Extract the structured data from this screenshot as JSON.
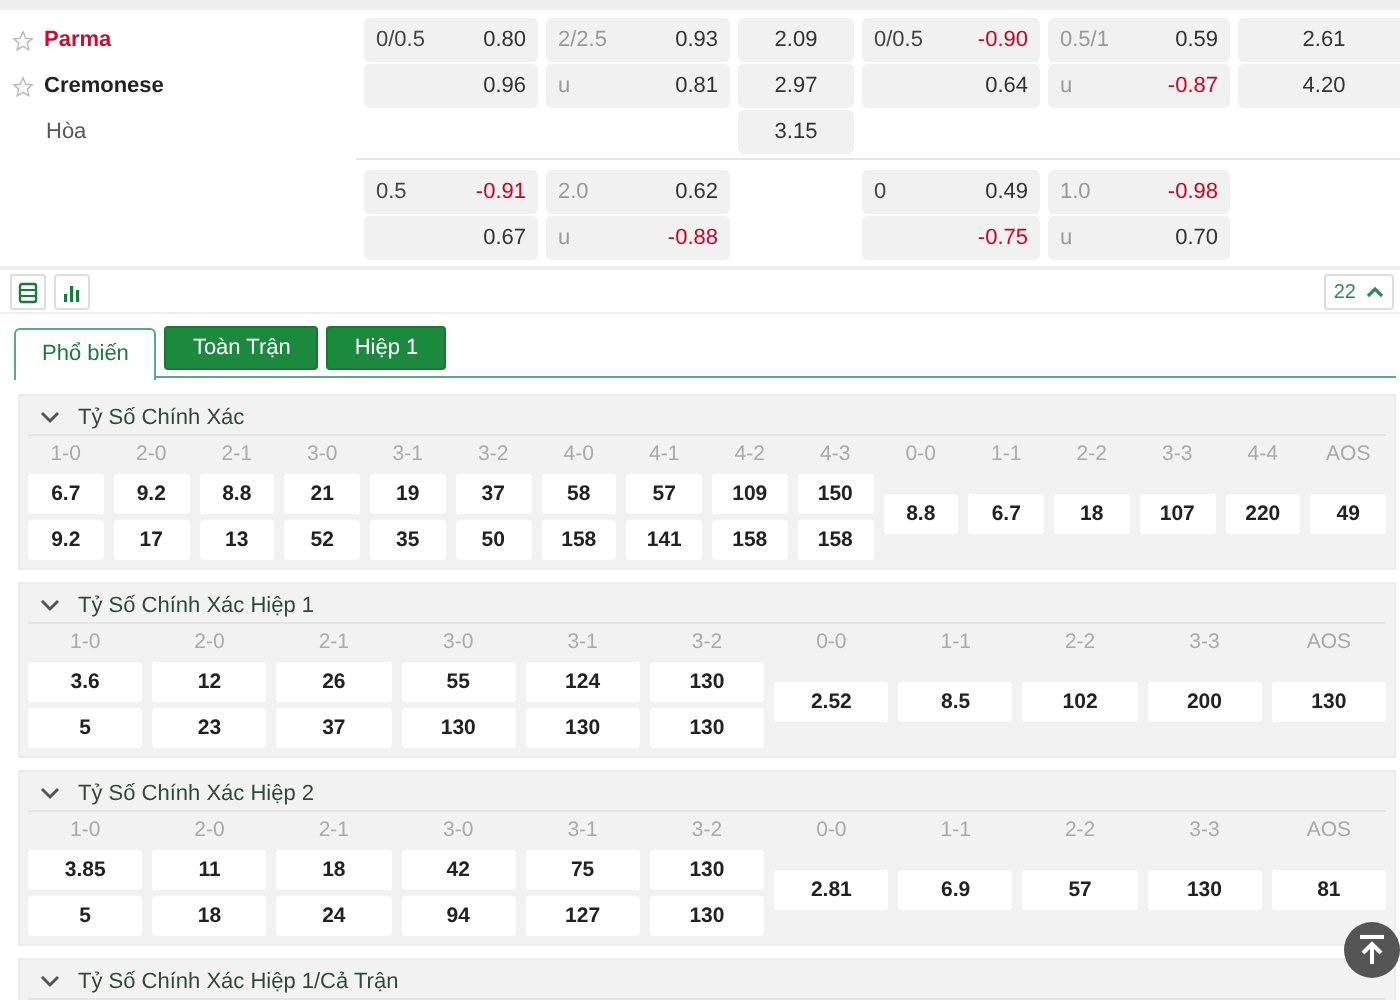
{
  "main_odds": {
    "rows": [
      {
        "team": {
          "name": "Parma",
          "kind": "home"
        },
        "cells": [
          {
            "kind": "pair",
            "line": "0/0.5",
            "price": "0.80",
            "negative": false
          },
          {
            "kind": "pair",
            "line": "2/2.5",
            "price": "0.93",
            "negative": false
          },
          {
            "kind": "single",
            "value": "2.09"
          },
          {
            "kind": "pair",
            "line": "0/0.5",
            "price": "-0.90",
            "negative": true
          },
          {
            "kind": "pair",
            "line": "0.5/1",
            "price": "0.59",
            "negative": false
          },
          {
            "kind": "single",
            "value": "2.61"
          }
        ]
      },
      {
        "team": {
          "name": "Cremonese",
          "kind": "away"
        },
        "cells": [
          {
            "kind": "pair",
            "price": "0.96",
            "negative": false
          },
          {
            "kind": "pair",
            "line": "u",
            "price": "0.81",
            "negative": false
          },
          {
            "kind": "single",
            "value": "2.97"
          },
          {
            "kind": "pair",
            "price": "0.64",
            "negative": false
          },
          {
            "kind": "pair",
            "line": "u",
            "price": "-0.87",
            "negative": true
          },
          {
            "kind": "single",
            "value": "4.20"
          }
        ]
      },
      {
        "team": {
          "name": "Hòa",
          "kind": "draw"
        },
        "cells": [
          {
            "kind": "empty"
          },
          {
            "kind": "empty"
          },
          {
            "kind": "single",
            "value": "3.15"
          },
          {
            "kind": "empty"
          },
          {
            "kind": "empty"
          },
          {
            "kind": "empty"
          }
        ]
      },
      {
        "cells": [
          {
            "kind": "pair",
            "line": "0.5",
            "price": "-0.91",
            "negative": true
          },
          {
            "kind": "pair",
            "line": "2.0",
            "price": "0.62",
            "negative": false
          },
          {
            "kind": "empty"
          },
          {
            "kind": "pair",
            "line": "0",
            "price": "0.49",
            "negative": false
          },
          {
            "kind": "pair",
            "line": "1.0",
            "price": "-0.98",
            "negative": true
          },
          {
            "kind": "empty"
          }
        ]
      },
      {
        "cells": [
          {
            "kind": "pair",
            "price": "0.67",
            "negative": false
          },
          {
            "kind": "pair",
            "line": "u",
            "price": "-0.88",
            "negative": true
          },
          {
            "kind": "empty"
          },
          {
            "kind": "pair",
            "price": "-0.75",
            "negative": true
          },
          {
            "kind": "pair",
            "line": "u",
            "price": "0.70",
            "negative": false
          },
          {
            "kind": "empty"
          }
        ]
      }
    ]
  },
  "toolbar": {
    "market_count": "22"
  },
  "tabs": [
    {
      "label": "Phổ biến",
      "selected": true
    },
    {
      "label": "Toàn Trận",
      "selected": false
    },
    {
      "label": "Hiệp 1",
      "selected": false
    }
  ],
  "markets": [
    {
      "title": "Tỷ Số Chính Xác",
      "expanded": true,
      "columns": [
        {
          "score": "1-0",
          "values": [
            "6.7",
            "9.2"
          ]
        },
        {
          "score": "2-0",
          "values": [
            "9.2",
            "17"
          ]
        },
        {
          "score": "2-1",
          "values": [
            "8.8",
            "13"
          ]
        },
        {
          "score": "3-0",
          "values": [
            "21",
            "52"
          ]
        },
        {
          "score": "3-1",
          "values": [
            "19",
            "35"
          ]
        },
        {
          "score": "3-2",
          "values": [
            "37",
            "50"
          ]
        },
        {
          "score": "4-0",
          "values": [
            "58",
            "158"
          ]
        },
        {
          "score": "4-1",
          "values": [
            "57",
            "141"
          ]
        },
        {
          "score": "4-2",
          "values": [
            "109",
            "158"
          ]
        },
        {
          "score": "4-3",
          "values": [
            "150",
            "158"
          ]
        },
        {
          "score": "0-0",
          "values": [
            "8.8"
          ]
        },
        {
          "score": "1-1",
          "values": [
            "6.7"
          ]
        },
        {
          "score": "2-2",
          "values": [
            "18"
          ]
        },
        {
          "score": "3-3",
          "values": [
            "107"
          ]
        },
        {
          "score": "4-4",
          "values": [
            "220"
          ]
        },
        {
          "score": "AOS",
          "values": [
            "49"
          ]
        }
      ]
    },
    {
      "title": "Tỷ Số Chính Xác Hiệp 1",
      "expanded": true,
      "columns": [
        {
          "score": "1-0",
          "values": [
            "3.6",
            "5"
          ]
        },
        {
          "score": "2-0",
          "values": [
            "12",
            "23"
          ]
        },
        {
          "score": "2-1",
          "values": [
            "26",
            "37"
          ]
        },
        {
          "score": "3-0",
          "values": [
            "55",
            "130"
          ]
        },
        {
          "score": "3-1",
          "values": [
            "124",
            "130"
          ]
        },
        {
          "score": "3-2",
          "values": [
            "130",
            "130"
          ]
        },
        {
          "score": "0-0",
          "values": [
            "2.52"
          ]
        },
        {
          "score": "1-1",
          "values": [
            "8.5"
          ]
        },
        {
          "score": "2-2",
          "values": [
            "102"
          ]
        },
        {
          "score": "3-3",
          "values": [
            "200"
          ]
        },
        {
          "score": "AOS",
          "values": [
            "130"
          ]
        }
      ]
    },
    {
      "title": "Tỷ Số Chính Xác Hiệp 2",
      "expanded": true,
      "columns": [
        {
          "score": "1-0",
          "values": [
            "3.85",
            "5"
          ]
        },
        {
          "score": "2-0",
          "values": [
            "11",
            "18"
          ]
        },
        {
          "score": "2-1",
          "values": [
            "18",
            "24"
          ]
        },
        {
          "score": "3-0",
          "values": [
            "42",
            "94"
          ]
        },
        {
          "score": "3-1",
          "values": [
            "75",
            "127"
          ]
        },
        {
          "score": "3-2",
          "values": [
            "130",
            "130"
          ]
        },
        {
          "score": "0-0",
          "values": [
            "2.81"
          ]
        },
        {
          "score": "1-1",
          "values": [
            "6.9"
          ]
        },
        {
          "score": "2-2",
          "values": [
            "57"
          ]
        },
        {
          "score": "3-3",
          "values": [
            "130"
          ]
        },
        {
          "score": "AOS",
          "values": [
            "81"
          ]
        }
      ]
    },
    {
      "title": "Tỷ Số Chính Xác Hiệp 1/Cả Trận",
      "expanded": true
    }
  ]
}
